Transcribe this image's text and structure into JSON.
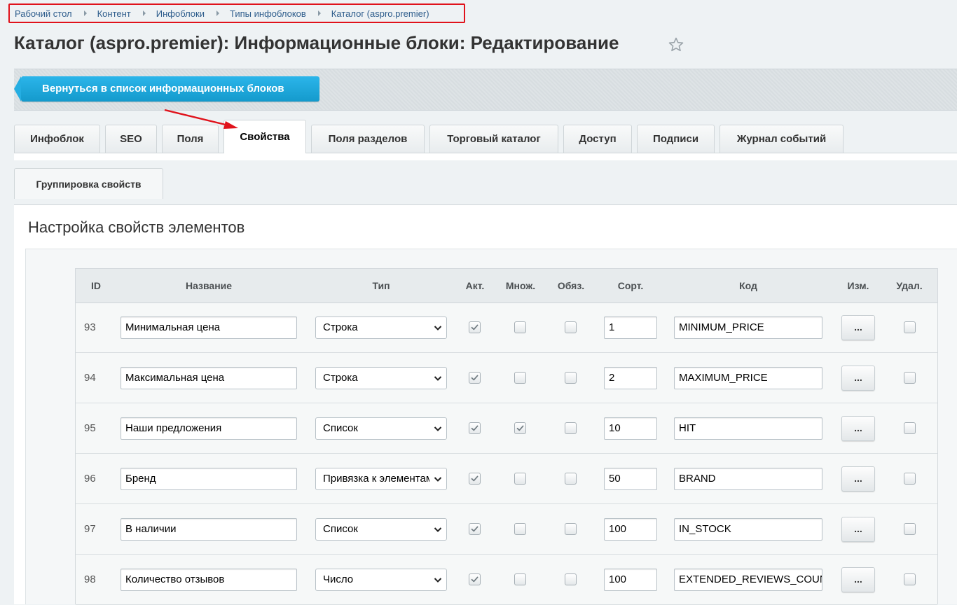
{
  "breadcrumb": [
    "Рабочий стол",
    "Контент",
    "Инфоблоки",
    "Типы инфоблоков",
    "Каталог (aspro.premier)"
  ],
  "page_title": "Каталог (aspro.premier): Информационные блоки: Редактирование",
  "toolbar": {
    "back_label": "Вернуться в список информационных блоков"
  },
  "tabs": [
    "Инфоблок",
    "SEO",
    "Поля",
    "Свойства",
    "Поля разделов",
    "Торговый каталог",
    "Доступ",
    "Подписи",
    "Журнал событий"
  ],
  "active_tab": "Свойства",
  "subtab": "Группировка свойств",
  "section_title": "Настройка свойств элементов",
  "table": {
    "headers": {
      "id": "ID",
      "name": "Название",
      "type": "Тип",
      "active": "Акт.",
      "multiple": "Множ.",
      "required": "Обяз.",
      "sort": "Сорт.",
      "code": "Код",
      "edit": "Изм.",
      "delete": "Удал."
    },
    "edit_button_label": "...",
    "rows": [
      {
        "id": "93",
        "name": "Минимальная цена",
        "type": "Строка",
        "active": true,
        "multiple": false,
        "required": false,
        "sort": "1",
        "code": "MINIMUM_PRICE",
        "delete": false
      },
      {
        "id": "94",
        "name": "Максимальная цена",
        "type": "Строка",
        "active": true,
        "multiple": false,
        "required": false,
        "sort": "2",
        "code": "MAXIMUM_PRICE",
        "delete": false
      },
      {
        "id": "95",
        "name": "Наши предложения",
        "type": "Список",
        "active": true,
        "multiple": true,
        "required": false,
        "sort": "10",
        "code": "HIT",
        "delete": false
      },
      {
        "id": "96",
        "name": "Бренд",
        "type": "Привязка к элементам",
        "active": true,
        "multiple": false,
        "required": false,
        "sort": "50",
        "code": "BRAND",
        "delete": false
      },
      {
        "id": "97",
        "name": "В наличии",
        "type": "Список",
        "active": true,
        "multiple": false,
        "required": false,
        "sort": "100",
        "code": "IN_STOCK",
        "delete": false
      },
      {
        "id": "98",
        "name": "Количество отзывов",
        "type": "Число",
        "active": true,
        "multiple": false,
        "required": false,
        "sort": "100",
        "code": "EXTENDED_REVIEWS_COUNT",
        "delete": false
      }
    ]
  },
  "colors": {
    "accent": "#1ea6dc",
    "annotation": "#e0121b"
  }
}
